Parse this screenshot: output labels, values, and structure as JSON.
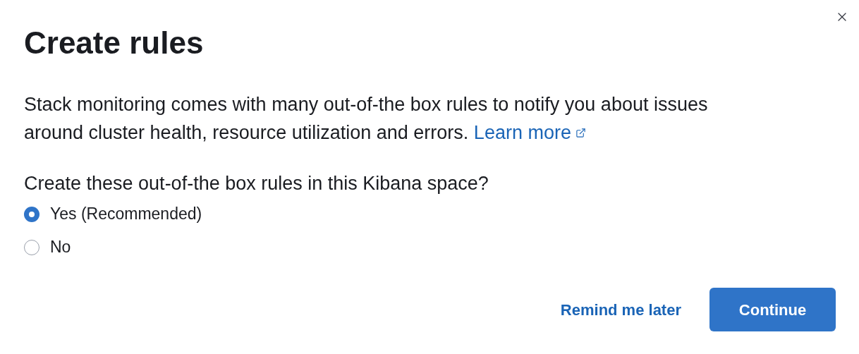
{
  "modal": {
    "title": "Create rules"
  },
  "description": {
    "text": "Stack monitoring comes with many out-of-the box rules to notify you about issues around cluster health, resource utilization and errors.",
    "link": "Learn more"
  },
  "question": "Create these out-of-the box rules in this Kibana space?",
  "options": [
    {
      "label": "Yes (Recommended)",
      "selected": true
    },
    {
      "label": "No",
      "selected": false
    }
  ],
  "actions": [
    {
      "kind": "link",
      "label": "Remind me later"
    },
    {
      "kind": "primary",
      "label": "Continue"
    }
  ]
}
